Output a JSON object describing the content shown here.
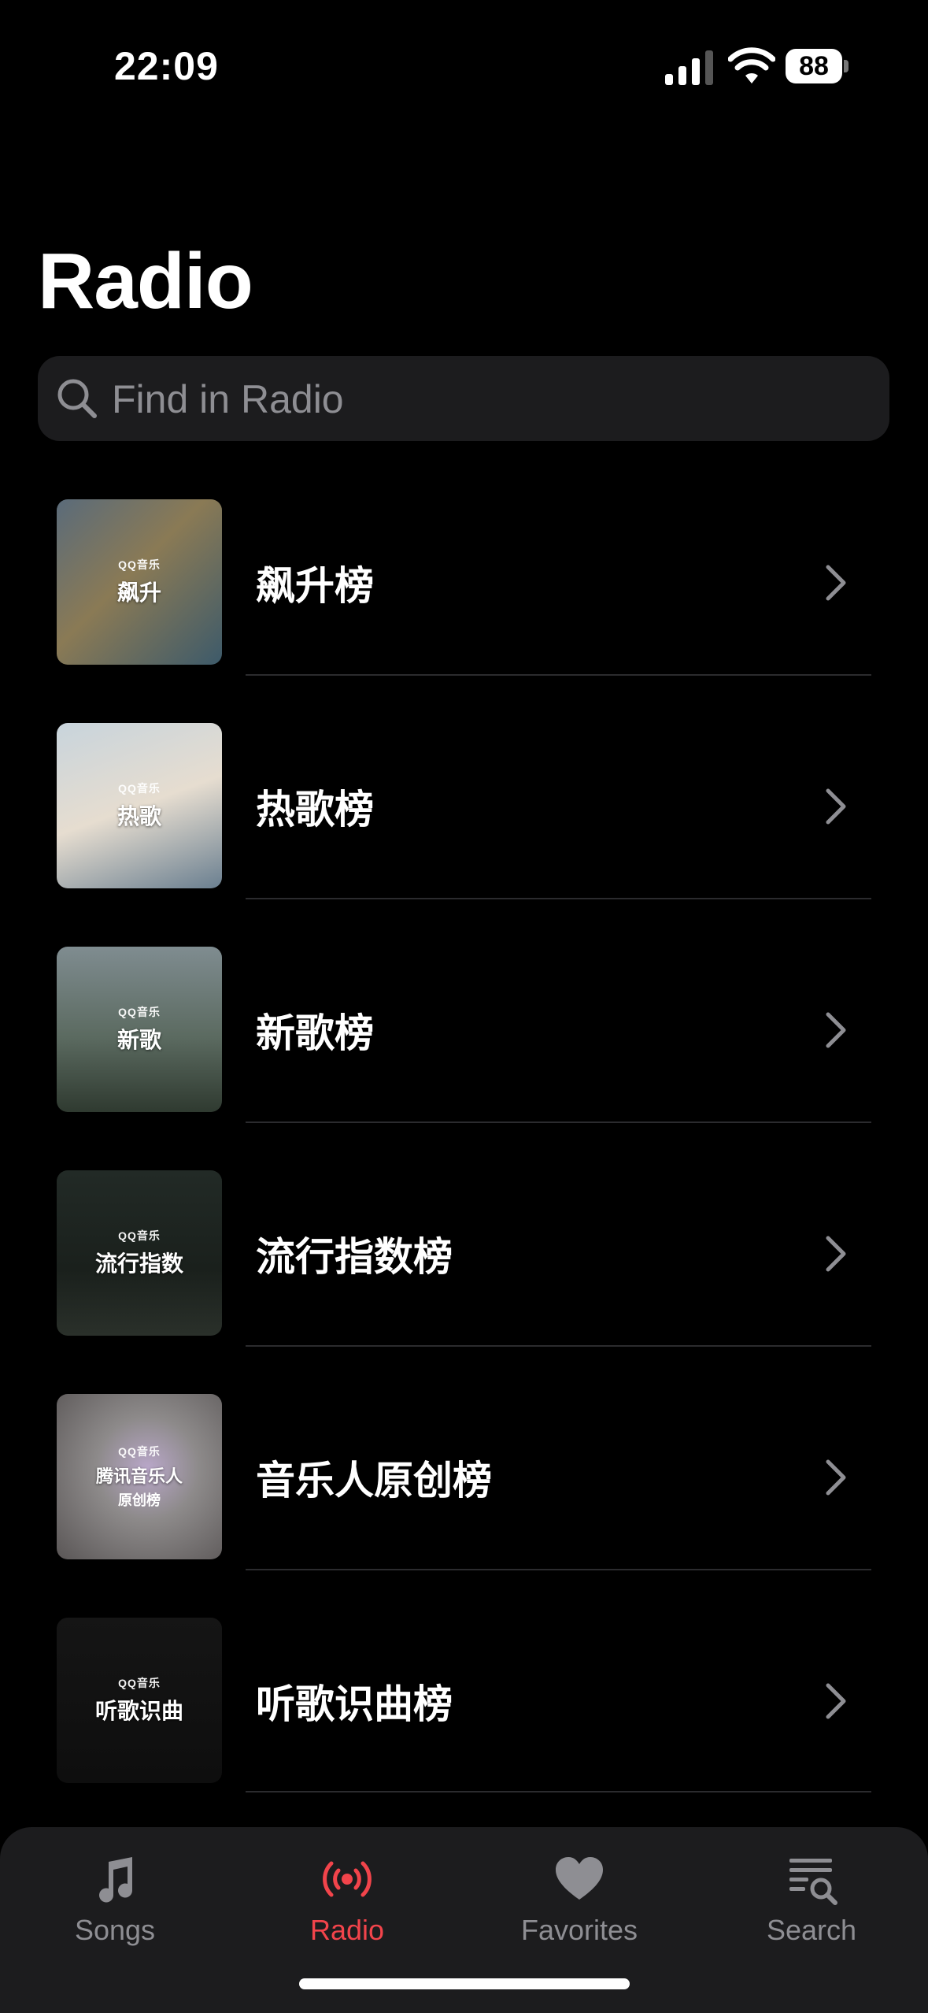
{
  "status_bar": {
    "time": "22:09",
    "battery": "88"
  },
  "header": {
    "title": "Radio"
  },
  "search": {
    "placeholder": "Find in Radio"
  },
  "list": [
    {
      "title": "飙升榜",
      "thumb_label": "飙升",
      "thumb_label2": "",
      "brand": "QQ音乐"
    },
    {
      "title": "热歌榜",
      "thumb_label": "热歌",
      "thumb_label2": "",
      "brand": "QQ音乐"
    },
    {
      "title": "新歌榜",
      "thumb_label": "新歌",
      "thumb_label2": "",
      "brand": "QQ音乐"
    },
    {
      "title": "流行指数榜",
      "thumb_label": "流行指数",
      "thumb_label2": "",
      "brand": "QQ音乐"
    },
    {
      "title": "音乐人原创榜",
      "thumb_label": "腾讯音乐人",
      "thumb_label2": "原创榜",
      "brand": "QQ音乐"
    },
    {
      "title": "听歌识曲榜",
      "thumb_label": "听歌识曲",
      "thumb_label2": "",
      "brand": "QQ音乐"
    }
  ],
  "tabs": [
    {
      "label": "Songs",
      "icon": "music-note-icon"
    },
    {
      "label": "Radio",
      "icon": "broadcast-icon"
    },
    {
      "label": "Favorites",
      "icon": "heart-icon"
    },
    {
      "label": "Search",
      "icon": "search-list-icon"
    }
  ],
  "colors": {
    "accent": "#f2444b",
    "background": "#000000",
    "secondary_text": "#8e8e93"
  }
}
